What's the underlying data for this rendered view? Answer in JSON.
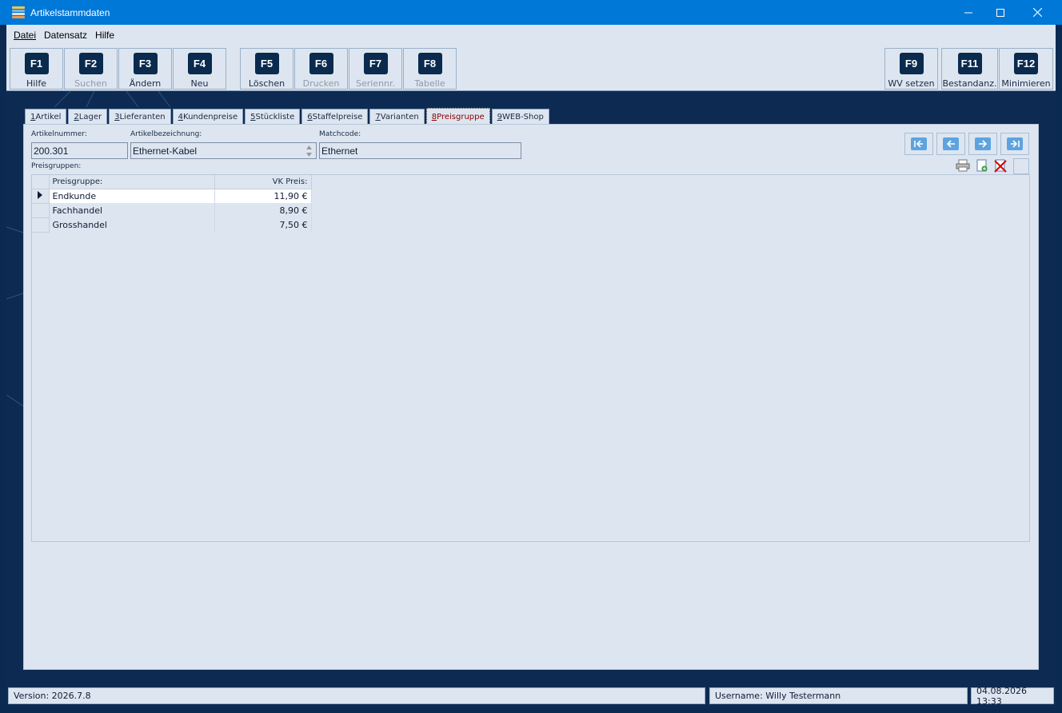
{
  "window": {
    "title": "Artikelstammdaten"
  },
  "menu": [
    {
      "label": "Datei"
    },
    {
      "label": "Datensatz"
    },
    {
      "label": "Hilfe"
    }
  ],
  "toolbar": {
    "left": [
      {
        "key": "F1",
        "label": "Hilfe",
        "enabled": true
      },
      {
        "key": "F2",
        "label": "Suchen",
        "enabled": false
      },
      {
        "key": "F3",
        "label": "Ändern",
        "enabled": true
      },
      {
        "key": "F4",
        "label": "Neu",
        "enabled": true
      },
      {
        "key": "F5",
        "label": "Löschen",
        "enabled": true
      },
      {
        "key": "F6",
        "label": "Drucken",
        "enabled": false
      },
      {
        "key": "F7",
        "label": "Seriennr.",
        "enabled": false
      },
      {
        "key": "F8",
        "label": "Tabelle",
        "enabled": false
      }
    ],
    "right": [
      {
        "key": "F9",
        "label": "WV setzen",
        "enabled": true
      },
      {
        "key": "F11",
        "label": "Bestandanz.",
        "enabled": true
      },
      {
        "key": "F12",
        "label": "Minimieren",
        "enabled": true
      }
    ]
  },
  "tabs": [
    {
      "num": "1",
      "label": " Artikel"
    },
    {
      "num": "2",
      "label": " Lager"
    },
    {
      "num": "3",
      "label": " Lieferanten"
    },
    {
      "num": "4",
      "label": " Kundenpreise"
    },
    {
      "num": "5",
      "label": " Stückliste"
    },
    {
      "num": "6",
      "label": " Staffelpreise"
    },
    {
      "num": "7",
      "label": " Varianten"
    },
    {
      "num": "8",
      "label": " Preisgruppe",
      "active": true
    },
    {
      "num": "9",
      "label": " WEB-Shop"
    }
  ],
  "form": {
    "artikelnummer_label": "Artikelnummer:",
    "artikelnummer": "200.301",
    "bezeichnung_label": "Artikelbezeichnung:",
    "bezeichnung": "Ethernet-Kabel",
    "matchcode_label": "Matchcode:",
    "matchcode": "Ethernet",
    "preisgruppen_label": "Preisgruppen:"
  },
  "grid": {
    "headers": {
      "gruppe": "Preisgruppe:",
      "preis": "VK Preis:"
    },
    "rows": [
      {
        "gruppe": "Endkunde",
        "preis": "11,90 €"
      },
      {
        "gruppe": "Fachhandel",
        "preis": "8,90 €"
      },
      {
        "gruppe": "Grosshandel",
        "preis": "7,50 €"
      }
    ]
  },
  "status": {
    "version": "Version: 2026.7.8",
    "user": "Username: Willy Testermann",
    "datetime": "04.08.2026 13:33"
  },
  "colors": {
    "titlebar": "#0078d7",
    "panel": "#dde6f0",
    "background": "#0d2b52",
    "active_tab_text": "#8b0000"
  },
  "icons": [
    "app-icon",
    "minimize-icon",
    "maximize-icon",
    "close-icon",
    "first-record-icon",
    "prev-record-icon",
    "next-record-icon",
    "last-record-icon",
    "print-icon",
    "new-document-icon",
    "delete-icon"
  ]
}
